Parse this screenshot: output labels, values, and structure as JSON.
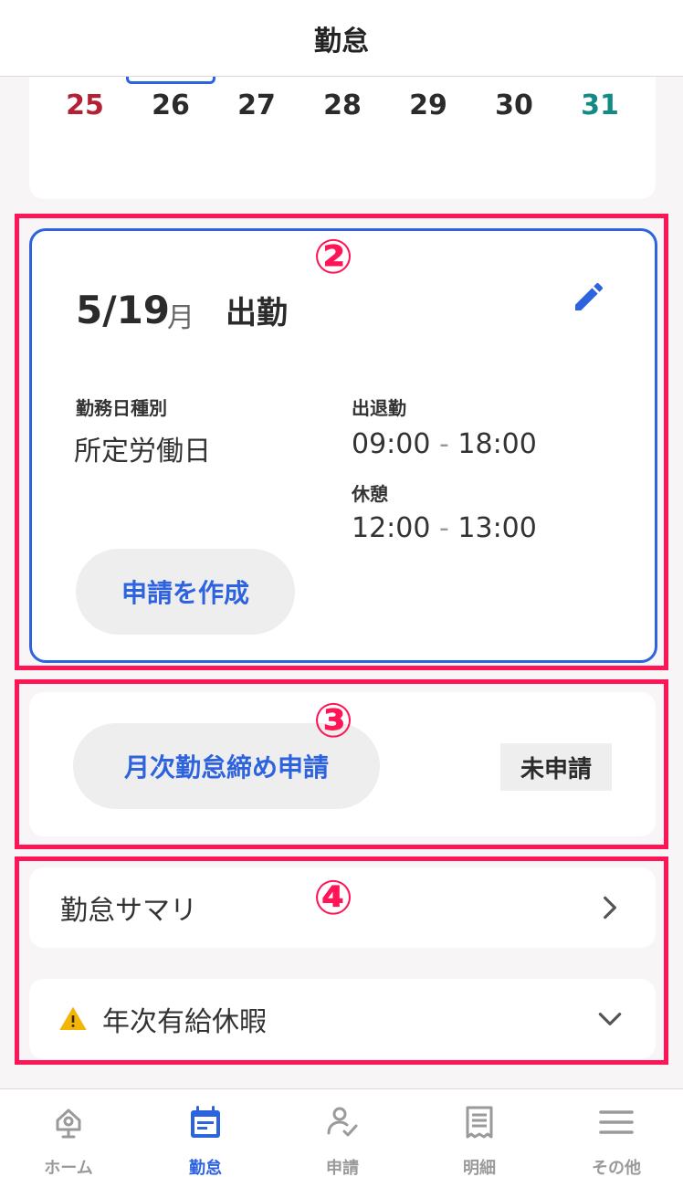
{
  "header": {
    "title": "勤怠"
  },
  "week": {
    "days": [
      "25",
      "26",
      "27",
      "28",
      "29",
      "30",
      "31"
    ],
    "selected_index": 1
  },
  "annotations": {
    "n2": "②",
    "n3": "③",
    "n4": "④"
  },
  "day_card": {
    "date": "5/19",
    "day_of_week": "月",
    "status": "出勤",
    "work_type_label": "勤務日種別",
    "work_type_value": "所定労働日",
    "attendance_label": "出退勤",
    "attendance_start": "09:00",
    "attendance_end": "18:00",
    "break_label": "休憩",
    "break_start": "12:00",
    "break_end": "13:00",
    "range_sep": "-",
    "create_request_label": "申請を作成"
  },
  "month_close": {
    "button_label": "月次勤怠締め申請",
    "status_badge": "未申請"
  },
  "summary": {
    "label": "勤怠サマリ"
  },
  "paid_leave": {
    "label": "年次有給休暇"
  },
  "tabs": [
    {
      "label": "ホーム",
      "icon": "home-icon"
    },
    {
      "label": "勤怠",
      "icon": "calendar-icon"
    },
    {
      "label": "申請",
      "icon": "request-icon"
    },
    {
      "label": "明細",
      "icon": "receipt-icon"
    },
    {
      "label": "その他",
      "icon": "menu-icon"
    }
  ],
  "colors": {
    "accent": "#2e63e0",
    "annotation": "#ff1456",
    "sunday": "#b22234",
    "saturday": "#138a86",
    "warning": "#f2b705"
  }
}
